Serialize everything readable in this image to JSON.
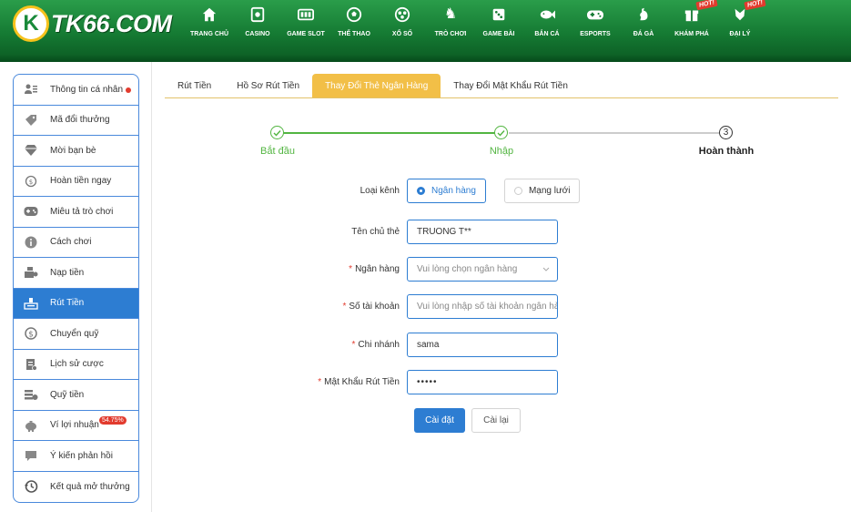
{
  "brand": {
    "logo_letter": "K",
    "logo_text": "TK66.COM"
  },
  "nav": {
    "items": [
      {
        "label": "TRANG CHỦ",
        "icon": "home-icon"
      },
      {
        "label": "CASINO",
        "icon": "casino-icon"
      },
      {
        "label": "GAME SLOT",
        "icon": "slot-icon"
      },
      {
        "label": "THỂ THAO",
        "icon": "soccer-ball-icon"
      },
      {
        "label": "XỔ SỐ",
        "icon": "lottery-icon"
      },
      {
        "label": "TRÒ CHƠI",
        "icon": "chess-knight-icon"
      },
      {
        "label": "GAME BÀI",
        "icon": "dice-icon"
      },
      {
        "label": "BẮN CÁ",
        "icon": "fish-icon"
      },
      {
        "label": "ESPORTS",
        "icon": "gamepad-icon"
      },
      {
        "label": "ĐÁ GÀ",
        "icon": "rooster-icon"
      },
      {
        "label": "KHÁM PHÁ",
        "icon": "gift-icon",
        "hot": "HOT!"
      },
      {
        "label": "ĐẠI LÝ",
        "icon": "agent-icon",
        "hot": "HOT!"
      }
    ]
  },
  "sidebar": {
    "items": [
      {
        "label": "Thông tin cá nhân",
        "icon": "user-card-icon",
        "dot": true
      },
      {
        "label": "Mã đổi thưởng",
        "icon": "tag-icon"
      },
      {
        "label": "Mời bạn bè",
        "icon": "diamond-icon"
      },
      {
        "label": "Hoàn tiền ngay",
        "icon": "refund-icon"
      },
      {
        "label": "Miêu tả trò chơi",
        "icon": "gamepad-icon"
      },
      {
        "label": "Cách chơi",
        "icon": "info-icon"
      },
      {
        "label": "Nạp tiền",
        "icon": "deposit-icon"
      },
      {
        "label": "Rút Tiền",
        "icon": "withdraw-icon",
        "active": true
      },
      {
        "label": "Chuyển quỹ",
        "icon": "dollar-coin-icon"
      },
      {
        "label": "Lịch sử cược",
        "icon": "history-doc-icon"
      },
      {
        "label": "Quỹ tiền",
        "icon": "fund-icon"
      },
      {
        "label": "Ví lợi nhuận",
        "icon": "piggy-bank-icon",
        "badge": "54.75%"
      },
      {
        "label": "Ý kiến phản hồi",
        "icon": "chat-icon"
      },
      {
        "label": "Kết quả mở thưởng",
        "icon": "clock-history-icon"
      }
    ]
  },
  "tabs": [
    {
      "label": "Rút Tiền"
    },
    {
      "label": "Hồ Sơ Rút Tiền"
    },
    {
      "label": "Thay Đổi Thẻ Ngân Hàng",
      "active": true
    },
    {
      "label": "Thay Đổi Mật Khẩu Rút Tiền"
    }
  ],
  "stepper": {
    "steps": [
      {
        "label": "Bắt đầu",
        "status": "done"
      },
      {
        "label": "Nhập",
        "status": "done"
      },
      {
        "label": "Hoàn thành",
        "status": "current",
        "number": "3"
      }
    ],
    "colors": {
      "done": "#52b541",
      "pending": "#cccccc"
    }
  },
  "form": {
    "channel_label": "Loại kênh",
    "channel_options": [
      {
        "label": "Ngân hàng",
        "selected": true
      },
      {
        "label": "Mạng lưới",
        "selected": false
      }
    ],
    "holder": {
      "label": "Tên chủ thẻ",
      "value": "TRUONG T**"
    },
    "bank": {
      "label": "Ngân hàng",
      "placeholder": "Vui lòng chọn ngân hàng"
    },
    "account": {
      "label": "Số tài khoản",
      "placeholder": "Vui lòng nhập số tài khoản ngân hà"
    },
    "branch": {
      "label": "Chi nhánh",
      "value": "sama"
    },
    "password": {
      "label": "Mật Khẩu Rút Tiền",
      "value": "•••••"
    },
    "submit_label": "Cài đặt",
    "reset_label": "Cài lại"
  },
  "colors": {
    "accent": "#2d7dd2",
    "tab_active": "#f2bf47",
    "header": "#1a8a3a",
    "required": "#e23b2e"
  }
}
